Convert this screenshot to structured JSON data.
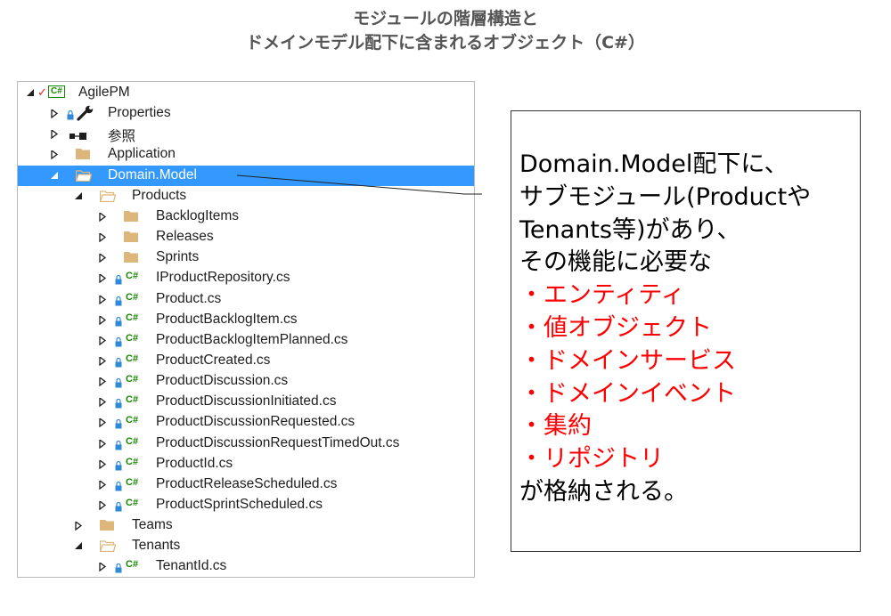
{
  "title": {
    "line1": "モジュールの階層構造と",
    "line2": "ドメインモデル配下に含まれるオブジェクト（C#）"
  },
  "tree": {
    "items": [
      {
        "name": "tree-item-agilepm",
        "label": "AgilePM",
        "icon": "csharp-project-icon",
        "expand": "expanded",
        "level": 0
      },
      {
        "name": "tree-item-properties",
        "label": "Properties",
        "icon": "wrench-icon",
        "expand": "collapsed",
        "level": 1
      },
      {
        "name": "tree-item-references",
        "label": "参照",
        "icon": "references-icon",
        "expand": "collapsed",
        "level": 1
      },
      {
        "name": "tree-item-application",
        "label": "Application",
        "icon": "folder-icon",
        "expand": "collapsed",
        "level": 1
      },
      {
        "name": "tree-item-domain-model",
        "label": "Domain.Model",
        "icon": "folder-open-icon",
        "expand": "expanded",
        "level": 1,
        "selected": true
      },
      {
        "name": "tree-item-products",
        "label": "Products",
        "icon": "folder-open-icon",
        "expand": "expanded",
        "level": 2
      },
      {
        "name": "tree-item-backlogitems",
        "label": "BacklogItems",
        "icon": "folder-icon",
        "expand": "collapsed",
        "level": 3
      },
      {
        "name": "tree-item-releases",
        "label": "Releases",
        "icon": "folder-icon",
        "expand": "collapsed",
        "level": 3
      },
      {
        "name": "tree-item-sprints",
        "label": "Sprints",
        "icon": "folder-icon",
        "expand": "collapsed",
        "level": 3
      },
      {
        "name": "tree-item-iproductrepository",
        "label": "IProductRepository.cs",
        "icon": "csharp-file-icon",
        "expand": "collapsed",
        "level": 3
      },
      {
        "name": "tree-item-product",
        "label": "Product.cs",
        "icon": "csharp-file-icon",
        "expand": "collapsed",
        "level": 3
      },
      {
        "name": "tree-item-productbacklogitem",
        "label": "ProductBacklogItem.cs",
        "icon": "csharp-file-icon",
        "expand": "collapsed",
        "level": 3
      },
      {
        "name": "tree-item-productbacklogitemplanned",
        "label": "ProductBacklogItemPlanned.cs",
        "icon": "csharp-file-icon",
        "expand": "collapsed",
        "level": 3
      },
      {
        "name": "tree-item-productcreated",
        "label": "ProductCreated.cs",
        "icon": "csharp-file-icon",
        "expand": "collapsed",
        "level": 3
      },
      {
        "name": "tree-item-productdiscussion",
        "label": "ProductDiscussion.cs",
        "icon": "csharp-file-icon",
        "expand": "collapsed",
        "level": 3
      },
      {
        "name": "tree-item-productdiscussioninitiated",
        "label": "ProductDiscussionInitiated.cs",
        "icon": "csharp-file-icon",
        "expand": "collapsed",
        "level": 3
      },
      {
        "name": "tree-item-productdiscussionrequested",
        "label": "ProductDiscussionRequested.cs",
        "icon": "csharp-file-icon",
        "expand": "collapsed",
        "level": 3
      },
      {
        "name": "tree-item-productdiscussionrequesttimedout",
        "label": "ProductDiscussionRequestTimedOut.cs",
        "icon": "csharp-file-icon",
        "expand": "collapsed",
        "level": 3
      },
      {
        "name": "tree-item-productid",
        "label": "ProductId.cs",
        "icon": "csharp-file-icon",
        "expand": "collapsed",
        "level": 3
      },
      {
        "name": "tree-item-productreleasescheduled",
        "label": "ProductReleaseScheduled.cs",
        "icon": "csharp-file-icon",
        "expand": "collapsed",
        "level": 3
      },
      {
        "name": "tree-item-productsprintscheduled",
        "label": "ProductSprintScheduled.cs",
        "icon": "csharp-file-icon",
        "expand": "collapsed",
        "level": 3
      },
      {
        "name": "tree-item-teams",
        "label": "Teams",
        "icon": "folder-icon",
        "expand": "collapsed",
        "level": 2
      },
      {
        "name": "tree-item-tenants",
        "label": "Tenants",
        "icon": "folder-open-icon",
        "expand": "expanded",
        "level": 2
      },
      {
        "name": "tree-item-tenantid",
        "label": "TenantId.cs",
        "icon": "csharp-file-icon",
        "expand": "collapsed",
        "level": 3
      }
    ]
  },
  "callout": {
    "lines": [
      {
        "text": "Domain.Model配下に、",
        "color": "#000000"
      },
      {
        "text": "サブモジュール(Productや",
        "color": "#000000"
      },
      {
        "text": "Tenants等)があり、",
        "color": "#000000"
      },
      {
        "text": "その機能に必要な",
        "color": "#000000"
      },
      {
        "text": "・エンティティ",
        "color": "#ff0000"
      },
      {
        "text": "・値オブジェクト",
        "color": "#ff0000"
      },
      {
        "text": "・ドメインサービス",
        "color": "#ff0000"
      },
      {
        "text": "・ドメインイベント",
        "color": "#ff0000"
      },
      {
        "text": "・集約",
        "color": "#ff0000"
      },
      {
        "text": "・リポジトリ",
        "color": "#ff0000"
      },
      {
        "text": "が格納される。",
        "color": "#000000"
      }
    ]
  },
  "colors": {
    "selection": "#3399ff",
    "csharp": "#178600",
    "folder": "#dcb67a",
    "lock": "#2f8ad6",
    "title": "#555555",
    "highlight": "#ff0000"
  },
  "csharp_glyph": "C#"
}
